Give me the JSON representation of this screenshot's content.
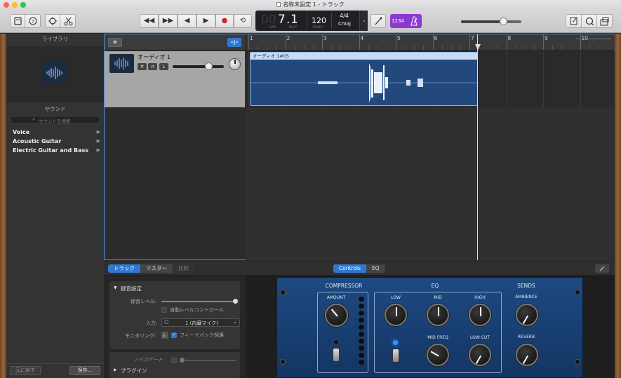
{
  "window": {
    "title": "名称未設定 1 - トラック"
  },
  "toolbar": {
    "transport": {
      "rewind": "◀◀",
      "forward": "▶▶",
      "to_start": "◀",
      "play": "▶",
      "record": "●",
      "cycle": "⟲"
    },
    "lcd": {
      "bar": "7",
      "beat": "1",
      "bar_prefix": "00",
      "bar_label": "BAR",
      "beat_label": "BEAT",
      "tempo": "120",
      "tempo_label": "TEMPO",
      "signature": "4/4",
      "key": "Cmaj"
    },
    "count_in": "1234",
    "master_volume_level": 0.7
  },
  "library": {
    "title": "ライブラリ"
  },
  "sounds": {
    "title": "サウンド",
    "search_placeholder": "サウンドを検索",
    "items": [
      "Voice",
      "Acoustic Guitar",
      "Electric Guitar and Bass"
    ]
  },
  "sidebar_footer": {
    "revert": "元に戻す",
    "save": "保存..."
  },
  "tracks": {
    "add": "+",
    "ruler": [
      "1",
      "2",
      "3",
      "4",
      "5",
      "6",
      "7",
      "8",
      "9",
      "10"
    ],
    "track1": {
      "name": "オーディオ 1",
      "volume_level": 0.7
    },
    "region": {
      "name": "オーディオ 1#05"
    }
  },
  "editor": {
    "tabs": [
      "トラック",
      "マスター",
      "比較"
    ],
    "view_tabs": [
      "Controls",
      "EQ"
    ],
    "recording": {
      "title": "録音設定",
      "level_label": "録音レベル:",
      "auto_level": "自動レベルコントロール",
      "input_label": "入力:",
      "input_value": "1 (内蔵マイク)",
      "monitoring_label": "モニタリング:",
      "feedback": "フィードバック保護",
      "noise_gate": "ノイズゲート:",
      "plugins": "プラグイン"
    }
  },
  "plugin": {
    "compressor": "COMPRESSOR",
    "amount": "AMOUNT",
    "eq": "EQ",
    "low": "LOW",
    "mid": "MID",
    "high": "HIGH",
    "mid_freq": "MID FREQ",
    "low_cut": "LOW CUT",
    "sends": "SENDS",
    "ambience": "AMBIENCE",
    "reverb": "REVERB"
  },
  "colors": {
    "accent": "#2f78d0",
    "region": "#23497c",
    "count_in": "#8d3ad0",
    "record": "#d0262a",
    "plugin_panel": "#18365f"
  }
}
